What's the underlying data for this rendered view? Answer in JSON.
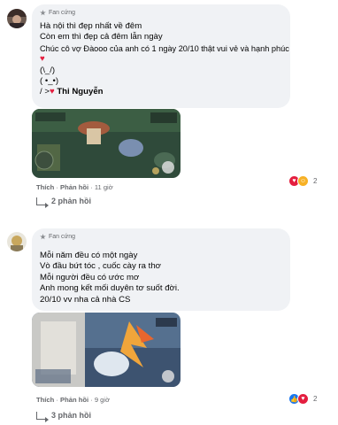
{
  "comments": [
    {
      "badge": "Fan cứng",
      "lines": [
        "Hà nội thì đẹp nhất về đêm",
        "Còn em thì đẹp cả đêm lẫn ngày",
        "Chúc cô vợ Đàooo của anh có 1 ngày 20/10 thật vui vẻ và hạnh phúc",
        "♥",
        "(\\_/)",
        "( •_•)",
        "/ >♥ Thi Nguyễn"
      ],
      "mention": "Thi Nguyễn",
      "actions": {
        "like": "Thích",
        "reply": "Phản hồi",
        "time": "11 giờ"
      },
      "reaction_count": "2",
      "replies": "2 phản hồi"
    },
    {
      "badge": "Fan cứng",
      "lines": [
        "Mỗi năm đều có một ngày",
        "Vò đầu bứt tóc , cuốc cày ra thơ",
        "Mỗi người đều có ước mơ",
        "Anh mong kết mối duyên tơ suốt đời.",
        "20/10 vv nha cả nhà CS"
      ],
      "actions": {
        "like": "Thích",
        "reply": "Phản hồi",
        "time": "9 giờ"
      },
      "reaction_count": "2",
      "replies": "3 phản hồi"
    }
  ],
  "colors": {
    "bubble": "#f0f2f5",
    "muted": "#65676b",
    "heart": "#e41e3f",
    "like": "#1877f2"
  }
}
